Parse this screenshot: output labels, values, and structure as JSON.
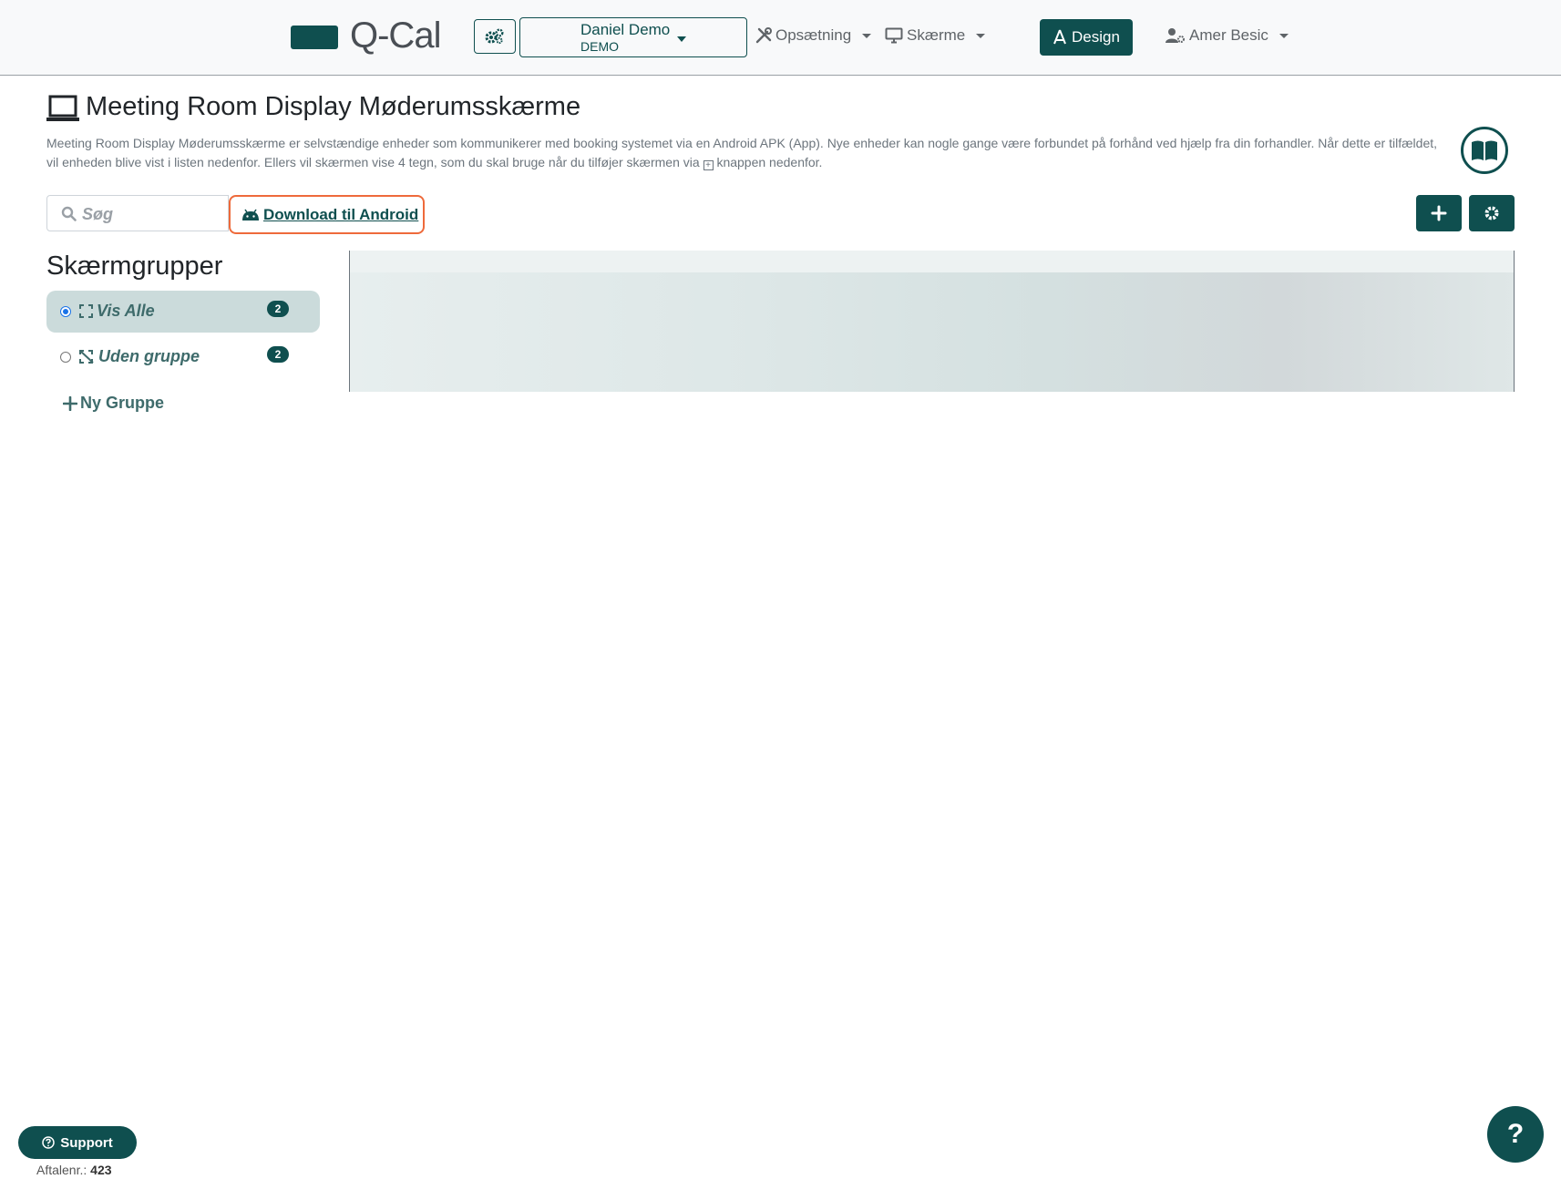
{
  "colors": {
    "primary": "#0f4f4f",
    "highlight": "#ee6a3b",
    "active_group_bg": "#cbdbdb"
  },
  "header": {
    "brand": "Q-Cal",
    "settings_icon": "gears-icon",
    "client": {
      "name": "Daniel Demo",
      "code": "DEMO"
    },
    "nav": {
      "setup": "Opsætning",
      "screens": "Skærme",
      "design": "Design",
      "user": "Amer Besic"
    }
  },
  "page": {
    "title": "Meeting Room Display Møderumsskærme",
    "description_before_icon": "Meeting Room Display Møderumsskærme er selvstændige enheder som kommunikerer med booking systemet via en Android APK (App). Nye enheder kan nogle gange være forbundet på forhånd ved hjælp fra din forhandler. Når dette er tilfældet, vil enheden blive vist i listen nedenfor. Ellers vil skærmen vise 4 tegn, som du skal bruge når du tilføjer skærmen via",
    "description_after_icon": "knappen nedenfor."
  },
  "toolbar": {
    "search_placeholder": "Søg",
    "android_link": "Download til Android"
  },
  "groups": {
    "title": "Skærmgrupper",
    "items": [
      {
        "label": "Vis Alle",
        "count": "2",
        "selected": true
      },
      {
        "label": "Uden gruppe",
        "count": "2",
        "selected": false
      }
    ],
    "new_group": "Ny Gruppe"
  },
  "footer": {
    "support": "Support",
    "agreement_label": "Aftalenr.:",
    "agreement_number": "423",
    "help": "?"
  }
}
